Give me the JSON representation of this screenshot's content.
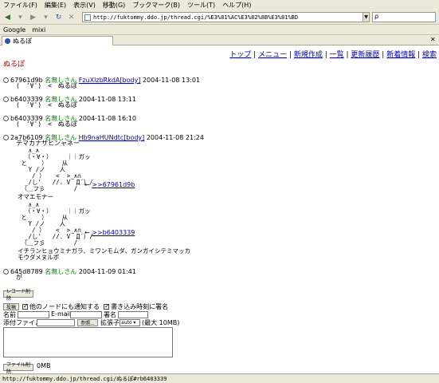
{
  "menu": [
    "ファイル(F)",
    "編集(E)",
    "表示(V)",
    "移動(G)",
    "ブックマーク(B)",
    "ツール(T)",
    "ヘルプ(H)"
  ],
  "toolbar": {
    "url": "http://fuktommy.ddo.jp/thread.cgi/%E3%81%AC%E3%82%8B%E3%81%BD"
  },
  "bookmarks": [
    "Google",
    "mixi"
  ],
  "tab": {
    "title": "ぬるぽ"
  },
  "nav": [
    "トップ",
    "メニュー",
    "新規作成",
    "一覧",
    "更新履歴",
    "新着情報",
    "検索"
  ],
  "page_title": "ぬるぽ",
  "posts": [
    {
      "id": "67961d9b",
      "name": "名無しさん",
      "mail": "FzuXlzbRkdA[body]",
      "date": "2004-11-08 13:01",
      "body": "(　'∀')　<　ぬるぽ"
    },
    {
      "id": "b6403339",
      "name": "名無しさん",
      "mail": "",
      "date": "2004-11-08 13:11",
      "body": "(　'∀')　<　ぬるぽ"
    },
    {
      "id": "b6403339",
      "name": "名無しさん",
      "mail": "",
      "date": "2004-11-08 16:10",
      "body": "(　'∀')　<　ぬるぽ"
    },
    {
      "id": "2a7b6109",
      "name": "名無しさん",
      "mail": "Hb9naHUNdtc[body]",
      "date": "2004-11-08 21:24",
      "body": "テマカナサヒンャネー"
    },
    {
      "id": "645d8789",
      "name": "名無しさん",
      "mail": "",
      "date": "2004-11-09 01:41",
      "body": "が"
    }
  ],
  "aa": {
    "art1": "   ∧_∧\n  （・∀・）    ｜｜ガッ\n と    ）    从\n   Y /ノ    人\n    / ）   <  >_∧∩\n  _/し'   //. V｀Д´）/\n （＿フ彡        /",
    "ref1": ">>67961d9b",
    "middle": "オマエモナー",
    "art2": "   ∧_∧\n  （・∀・）    ｜｜ガッ\n と    ）    从\n   Y /ノ    人\n    / ）   <  >_∧∩\n  _/し'   //. V｀Д´）/\n （＿フ彡        /",
    "ref2": ">>b6403339",
    "footer": "イチランヒョウミナガラ、ミワンモムダ、ガンガイシテミマッカ\nモウダメヌルポ"
  },
  "arrow": "←",
  "form": {
    "record_delete": "レコード削除",
    "submit": "投稿",
    "notify_label": "他のノードにも通知する",
    "dopost_label": "書き込み時刻に署名",
    "name_label": "名前",
    "email_label": "E-mail",
    "sign_label": "署名",
    "attach_label": "添付ファイル",
    "browse": "参照...",
    "suffix_label": "拡張子",
    "suffix_value": "auto",
    "max_label": "(最大 10MB)",
    "file_delete": "ファイル削除",
    "size": "0MB"
  },
  "status": "http://fuktommy.ddo.jp/thread.cgi/ぬるぽ#rb6403339"
}
